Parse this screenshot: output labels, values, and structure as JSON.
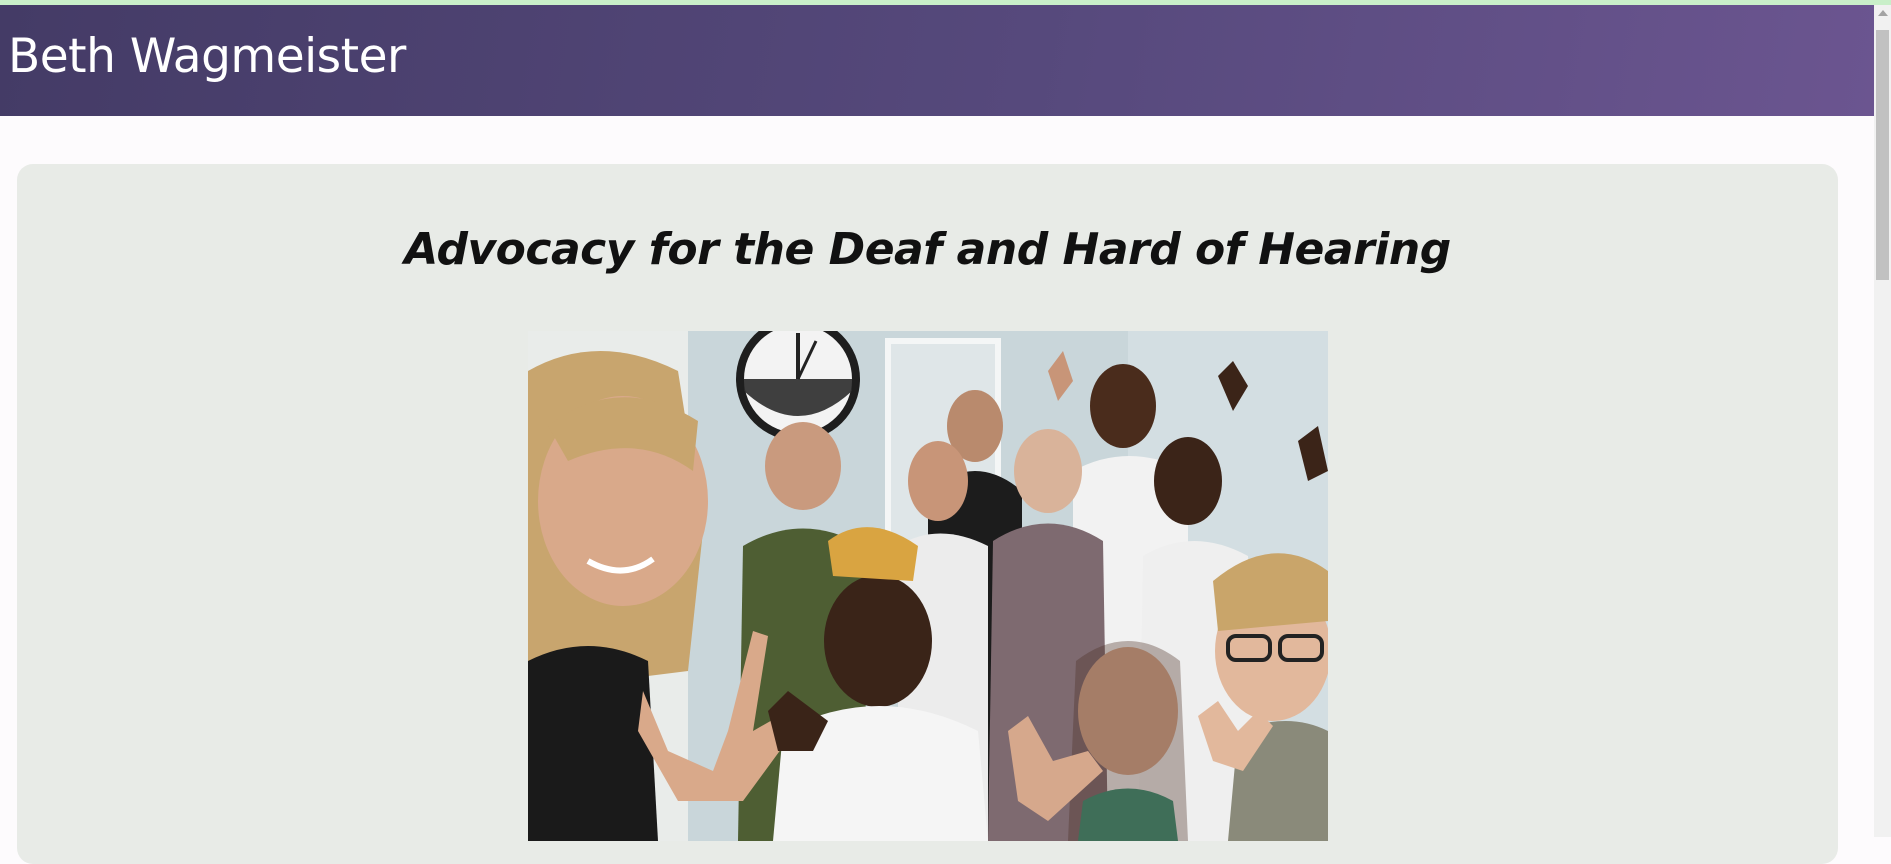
{
  "header": {
    "site_title": "Beth Wagmeister"
  },
  "main": {
    "heading": "Advocacy for the Deaf and Hard of Hearing"
  },
  "colors": {
    "header_gradient_start": "#443b66",
    "header_gradient_end": "#6b5590",
    "panel_background": "#e8ebe7",
    "page_background": "#fdfbfd",
    "top_strip": "#c9efc9"
  },
  "icons": {
    "scroll_up": "up-arrow-icon"
  }
}
